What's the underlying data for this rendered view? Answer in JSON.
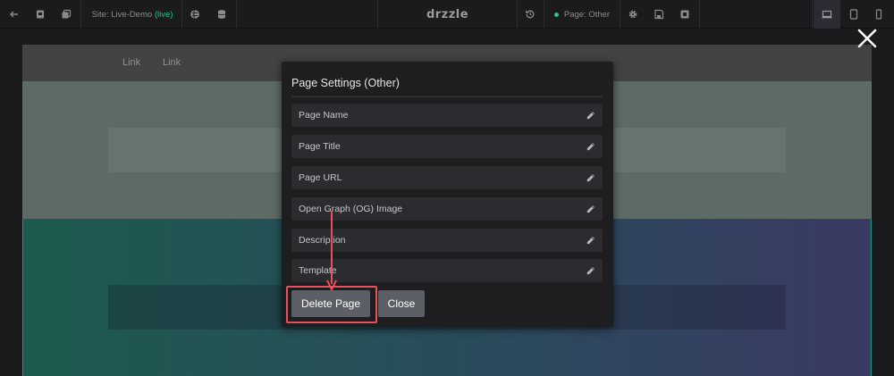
{
  "toolbar": {
    "site_label": "Site: Live-Demo",
    "site_status": "(live)",
    "logo": "drzzle",
    "page_label": "Page: Other",
    "icons": [
      "back-arrow-icon",
      "copy-page-icon",
      "duplicate-icon",
      "globe-icon",
      "database-icon",
      "history-icon",
      "gear-icon",
      "save-icon",
      "stop-icon",
      "desktop-icon",
      "tablet-icon",
      "mobile-icon"
    ]
  },
  "canvas": {
    "nav_links": [
      "Link",
      "Link"
    ]
  },
  "modal": {
    "title": "Page Settings (Other)",
    "fields": [
      "Page Name",
      "Page Title",
      "Page URL",
      "Open Graph (OG) Image",
      "Description",
      "Template"
    ],
    "delete_label": "Delete Page",
    "close_label": "Close"
  },
  "colors": {
    "accent": "#2ec08a",
    "highlight": "#e8505b",
    "modal_bg": "#1e1e21",
    "button_bg": "#5d5f66"
  }
}
